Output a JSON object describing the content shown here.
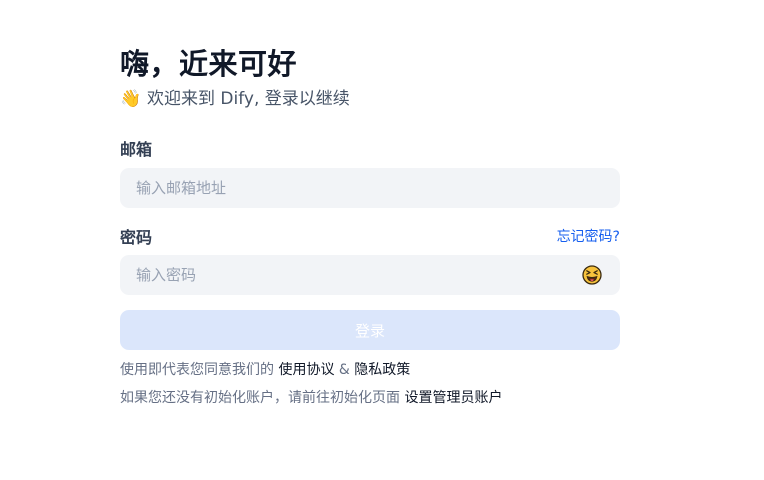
{
  "header": {
    "title": "嗨，近来可好",
    "wave_emoji": "👋",
    "subtitle": "欢迎来到 Dify, 登录以继续"
  },
  "form": {
    "email": {
      "label": "邮箱",
      "placeholder": "输入邮箱地址",
      "value": ""
    },
    "password": {
      "label": "密码",
      "forgot_label": "忘记密码?",
      "placeholder": "输入密码",
      "value": "",
      "toggle_icon": "squinting-face-with-tongue-icon"
    },
    "login_label": "登录"
  },
  "footer": {
    "terms_prefix": "使用即代表您同意我们的",
    "terms_link": "使用协议",
    "terms_and": "&",
    "privacy_link": "隐私政策",
    "setup_prefix": "如果您还没有初始化账户，请前往初始化页面",
    "setup_link": "设置管理员账户"
  },
  "colors": {
    "primary": "#155eef",
    "input_bg": "#f2f4f7",
    "button_disabled_bg": "#dbe6fb",
    "title": "#101828",
    "muted": "#667085"
  }
}
